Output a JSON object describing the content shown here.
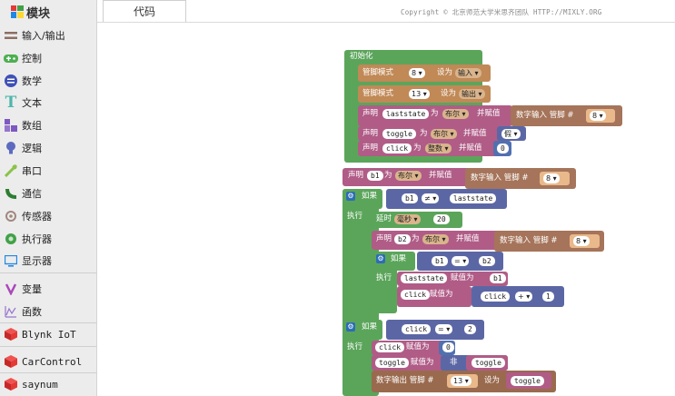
{
  "sidebar": {
    "title": "模块",
    "items": [
      {
        "label": "输入/输出",
        "icon": "io-icon",
        "color": "#8d6e63"
      },
      {
        "label": "控制",
        "icon": "gamepad-icon",
        "color": "#4caf50"
      },
      {
        "label": "数学",
        "icon": "math-icon",
        "color": "#3f51b5"
      },
      {
        "label": "文本",
        "icon": "text-icon",
        "color": "#4db6ac"
      },
      {
        "label": "数组",
        "icon": "array-icon",
        "color": "#7e57c2"
      },
      {
        "label": "逻辑",
        "icon": "bulb-icon",
        "color": "#5c6bc0"
      },
      {
        "label": "串口",
        "icon": "serial-icon",
        "color": "#8bc34a"
      },
      {
        "label": "通信",
        "icon": "comm-icon",
        "color": "#2e7d32"
      },
      {
        "label": "传感器",
        "icon": "sensor-icon",
        "color": "#a1887f"
      },
      {
        "label": "执行器",
        "icon": "actuator-icon",
        "color": "#43a047"
      },
      {
        "label": "显示器",
        "icon": "display-icon",
        "color": "#1e88e5"
      },
      {
        "label": "变量",
        "icon": "variable-icon",
        "color": "#ab47bc"
      },
      {
        "label": "函数",
        "icon": "function-icon",
        "color": "#9575cd"
      },
      {
        "label": "Blynk IoT",
        "icon": "cube-icon",
        "color": "#e53935"
      },
      {
        "label": "CarControl",
        "icon": "cube-icon",
        "color": "#e53935"
      },
      {
        "label": "saynum",
        "icon": "cube-icon",
        "color": "#e53935"
      }
    ]
  },
  "tabs": {
    "code": "代码"
  },
  "copyright": "Copyright © 北京师范大学米思齐团队 HTTP://MIXLY.ORG",
  "blocks": {
    "init": "初始化",
    "pinmode1": {
      "label": "管脚模式",
      "pin": "8",
      "set": "设为",
      "mode": "输入"
    },
    "pinmode2": {
      "label": "管脚模式",
      "pin": "13",
      "set": "设为",
      "mode": "输出"
    },
    "decl_laststate": {
      "declare": "声明",
      "var": "laststate",
      "as": "为",
      "type": "布尔",
      "assign": "并赋值",
      "value_label": "数字输入 管脚 #",
      "pin": "8"
    },
    "decl_toggle": {
      "declare": "声明",
      "var": "toggle",
      "as": "为",
      "type": "布尔",
      "assign": "并赋值",
      "value": "假"
    },
    "decl_click": {
      "declare": "声明",
      "var": "click",
      "as": "为",
      "type": "整数",
      "assign": "并赋值",
      "value": "0"
    },
    "decl_b1": {
      "declare": "声明",
      "var": "b1",
      "as": "为",
      "type": "布尔",
      "assign": "并赋值",
      "value_label": "数字输入 管脚 #",
      "pin": "8"
    },
    "if1": {
      "if": "如果",
      "left": "b1",
      "op": "≠",
      "right": "laststate",
      "do": "执行"
    },
    "delay": {
      "label": "延时",
      "unit": "毫秒",
      "value": "20"
    },
    "decl_b2": {
      "declare": "声明",
      "var": "b2",
      "as": "为",
      "type": "布尔",
      "assign": "并赋值",
      "value_label": "数字输入 管脚 #",
      "pin": "8"
    },
    "if2": {
      "if": "如果",
      "left": "b1",
      "op": "=",
      "right": "b2",
      "do": "执行"
    },
    "set_laststate": {
      "var": "laststate",
      "assign": "赋值为",
      "value": "b1"
    },
    "set_click": {
      "var": "click",
      "assign": "赋值为",
      "left": "click",
      "op": "+",
      "right": "1"
    },
    "if3": {
      "if": "如果",
      "left": "click",
      "op": "=",
      "right": "2",
      "do": "执行"
    },
    "set_click0": {
      "var": "click",
      "assign": "赋值为",
      "value": "0"
    },
    "set_toggle": {
      "var": "toggle",
      "assign": "赋值为",
      "not": "非",
      "value": "toggle"
    },
    "dout": {
      "label": "数字输出 管脚 #",
      "pin": "13",
      "set": "设为",
      "value": "toggle"
    }
  }
}
